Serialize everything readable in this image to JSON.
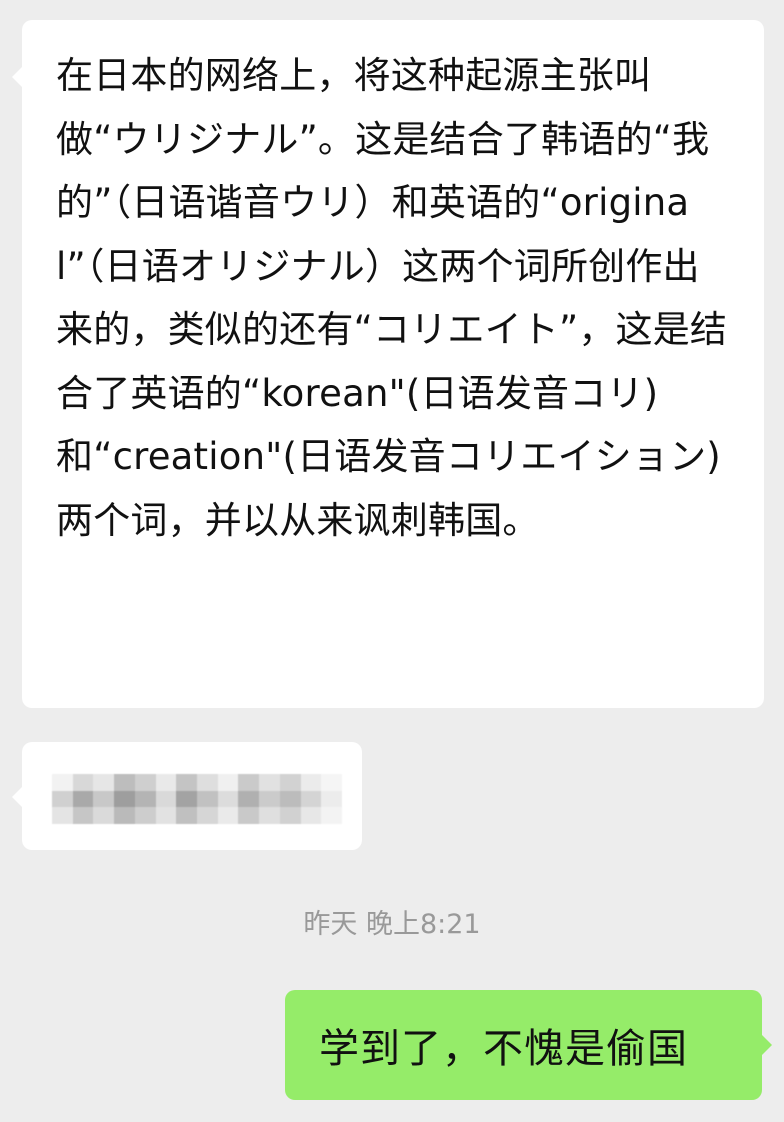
{
  "messages": [
    {
      "direction": "incoming",
      "text": "在日本的网络上，将这种起源主张叫做“ウリジナル”。这是结合了韩语的“我的”（日语谐音ウリ）和英语的“original”（日语オリジナル）这两个词所创作出来的，类似的还有“コリエイト”，这是结合了英语的“korean\"(日语发音コリ)和“creation\"(日语发音コリエイション)两个词，并以从来讽刺韩国。"
    },
    {
      "direction": "incoming",
      "content": "pixelated-hidden-text"
    },
    {
      "direction": "outgoing",
      "text": "学到了，不愧是偷国"
    }
  ],
  "timestamp": "昨天 晚上8:21",
  "colors": {
    "background": "#ededed",
    "incoming_bubble": "#ffffff",
    "outgoing_bubble": "#95ec69",
    "timestamp_text": "#999999"
  }
}
